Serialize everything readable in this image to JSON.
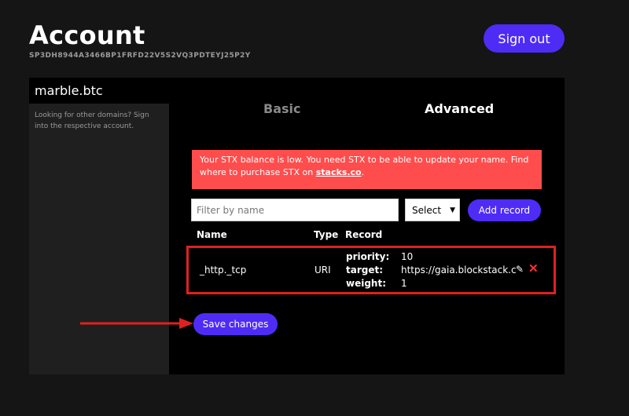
{
  "header": {
    "title": "Account",
    "address": "SP3DH8944A3466BP1FRFD22V5S2VQ3PDTEYJ25P2Y",
    "signout_label": "Sign out"
  },
  "sidebar": {
    "domain": "marble.btc",
    "help_text": "Looking for other domains? Sign into the respective account."
  },
  "tabs": [
    {
      "label": "Basic"
    },
    {
      "label": "Advanced"
    }
  ],
  "alert": {
    "text": "Your STX balance is low. You need STX to be able to update your name. Find where to purchase STX on ",
    "link": "stacks.co",
    "suffix": "."
  },
  "toolbar": {
    "filter_placeholder": "Filter by name",
    "select_value": "Select",
    "add_label": "Add record"
  },
  "table": {
    "headers": [
      "Name",
      "Type",
      "Record"
    ],
    "rows": [
      {
        "name": "_http._tcp",
        "type": "URI",
        "record": [
          {
            "key": "priority:",
            "value": "10"
          },
          {
            "key": "target:",
            "value": "https://gaia.blockstack.c"
          },
          {
            "key": "weight:",
            "value": "1"
          }
        ]
      }
    ]
  },
  "save_label": "Save changes",
  "colors": {
    "accent": "#4e2cf5",
    "alert": "#ff4d4d",
    "highlight": "#e02020"
  }
}
